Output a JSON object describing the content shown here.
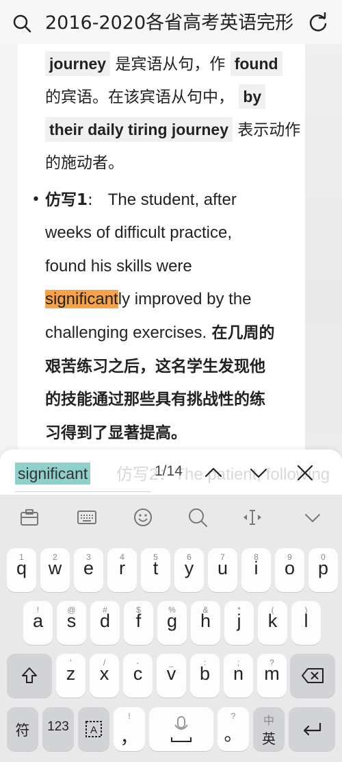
{
  "header": {
    "title": "2016-2020各省高考英语完形"
  },
  "article": {
    "line1": {
      "code1": "journey",
      "text1": "是宾语从句，作",
      "code2": "found"
    },
    "line2": {
      "text1": "的宾语。在该宾语从句中，",
      "code1": "by"
    },
    "line3": {
      "code1": "their daily tiring journey",
      "text1": "表示动作"
    },
    "line4": {
      "text1": "的施动者。"
    },
    "bullet": {
      "label": "仿写1",
      "colon": ":",
      "text": "The student, after"
    },
    "line6": {
      "text": "weeks of difficult practice,"
    },
    "line7": {
      "text": "found his skills were"
    },
    "line8": {
      "highlight": "significant",
      "rest": "ly improved by the"
    },
    "line9": {
      "text1": "challenging exercises.",
      "text2": "在几周的"
    },
    "line10": {
      "text": "艰苦练习之后，这名学生发现他"
    },
    "line11": {
      "text": "的技能通过那些具有挑战性的练"
    },
    "line12": {
      "text": "习得到了显著提高。"
    }
  },
  "find": {
    "query": "significant",
    "ghost_text": "仿写2：The patient, following",
    "counter": "1/14"
  },
  "keyboard": {
    "row1": [
      {
        "hint": "1",
        "key": "q"
      },
      {
        "hint": "2",
        "key": "w"
      },
      {
        "hint": "3",
        "key": "e"
      },
      {
        "hint": "4",
        "key": "r"
      },
      {
        "hint": "5",
        "key": "t"
      },
      {
        "hint": "6",
        "key": "y"
      },
      {
        "hint": "7",
        "key": "u"
      },
      {
        "hint": "8",
        "key": "i"
      },
      {
        "hint": "9",
        "key": "o"
      },
      {
        "hint": "0",
        "key": "p"
      }
    ],
    "row2": [
      {
        "hint": "!",
        "key": "a"
      },
      {
        "hint": "@",
        "key": "s"
      },
      {
        "hint": "#",
        "key": "d"
      },
      {
        "hint": "$",
        "key": "f"
      },
      {
        "hint": "%",
        "key": "g"
      },
      {
        "hint": "&",
        "key": "h"
      },
      {
        "hint": "*",
        "key": "j"
      },
      {
        "hint": "(",
        "key": "k"
      },
      {
        "hint": ")",
        "key": "l"
      }
    ],
    "row3": [
      {
        "hint": "'",
        "key": "z"
      },
      {
        "hint": "/",
        "key": "x"
      },
      {
        "hint": "-",
        "key": "c"
      },
      {
        "hint": "_",
        "key": "v"
      },
      {
        "hint": ":",
        "key": "b"
      },
      {
        "hint": ";",
        "key": "n"
      },
      {
        "hint": "?",
        "key": "m"
      }
    ],
    "symbols_label": "符",
    "numbers_label": "123",
    "comma_hint": "!",
    "comma": "，",
    "period_hint": "?",
    "period": "。",
    "lang_top": "中",
    "lang_bottom": "英"
  }
}
